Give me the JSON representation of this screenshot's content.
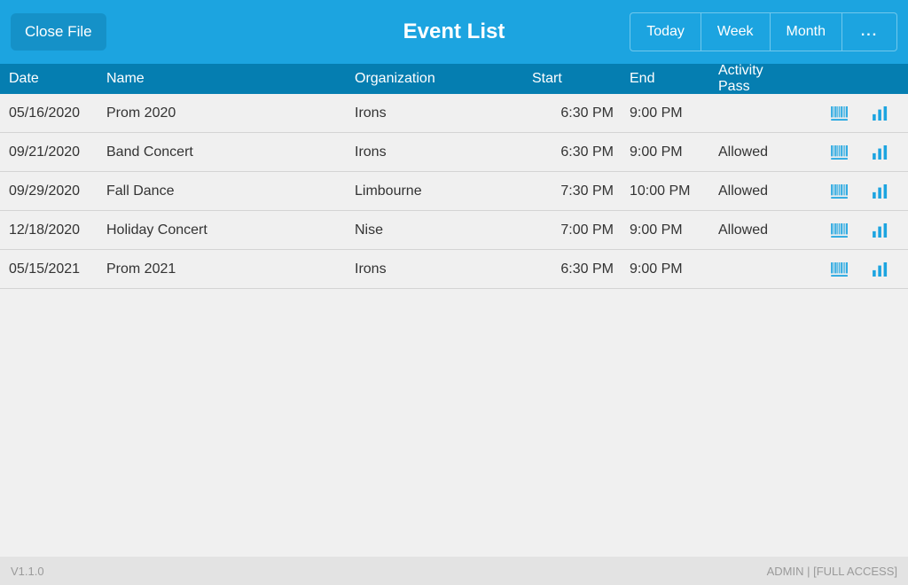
{
  "header": {
    "close_label": "Close File",
    "title": "Event List",
    "seg": {
      "today": "Today",
      "week": "Week",
      "month": "Month",
      "more": "..."
    }
  },
  "columns": {
    "date": "Date",
    "name": "Name",
    "org": "Organization",
    "start": "Start",
    "end": "End",
    "pass": "Activity Pass"
  },
  "events": [
    {
      "date": "05/16/2020",
      "name": "Prom 2020",
      "org": "Irons",
      "start": "6:30 PM",
      "end": "9:00 PM",
      "pass": ""
    },
    {
      "date": "09/21/2020",
      "name": "Band Concert",
      "org": "Irons",
      "start": "6:30 PM",
      "end": "9:00 PM",
      "pass": "Allowed"
    },
    {
      "date": "09/29/2020",
      "name": "Fall Dance",
      "org": "Limbourne",
      "start": "7:30 PM",
      "end": "10:00 PM",
      "pass": "Allowed"
    },
    {
      "date": "12/18/2020",
      "name": "Holiday Concert",
      "org": "Nise",
      "start": "7:00 PM",
      "end": "9:00 PM",
      "pass": "Allowed"
    },
    {
      "date": "05/15/2021",
      "name": "Prom 2021",
      "org": "Irons",
      "start": "6:30 PM",
      "end": "9:00 PM",
      "pass": ""
    }
  ],
  "footer": {
    "version": "V1.1.0",
    "access": "ADMIN | [FULL ACCESS]"
  },
  "icons": {
    "barcode": "barcode-icon",
    "chart": "bar-chart-icon"
  }
}
